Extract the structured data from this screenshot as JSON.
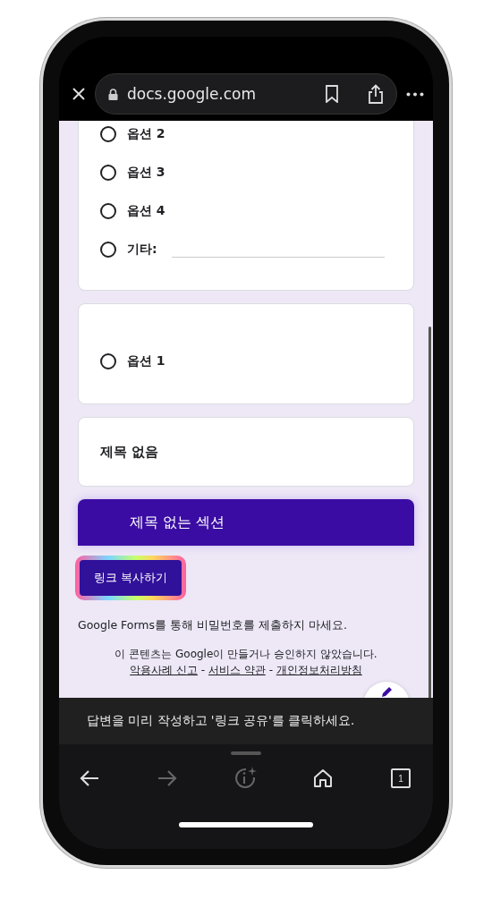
{
  "browser": {
    "url": "docs.google.com"
  },
  "cards": [
    {
      "kind": "choices",
      "options": [
        {
          "label": "옵션 2",
          "kind": "option",
          "selected": false
        },
        {
          "label": "옵션 3",
          "kind": "option",
          "selected": false
        },
        {
          "label": "옵션 4",
          "kind": "option",
          "selected": false
        },
        {
          "label": "기타:",
          "kind": "other",
          "selected": false
        }
      ]
    },
    {
      "kind": "choices",
      "options": [
        {
          "label": "옵션 1",
          "kind": "option",
          "selected": false
        }
      ]
    },
    {
      "kind": "title",
      "title": "제목 없음"
    }
  ],
  "section": {
    "title": "제목 없는 섹션"
  },
  "copy_button": {
    "label": "링크 복사하기"
  },
  "warning": "Google Forms를 통해 비밀번호를 제출하지 마세요.",
  "disclaimer": {
    "text": "이 콘텐츠는 Google이 만들거나 승인하지 않았습니다.",
    "separator": "-",
    "links": [
      "악용사례 신고",
      "서비스 약관",
      "개인정보처리방침"
    ]
  },
  "toast": "답변을 미리 작성하고 '링크 공유'를 클릭하세요.",
  "toolbar": {
    "tab_count": "1"
  }
}
